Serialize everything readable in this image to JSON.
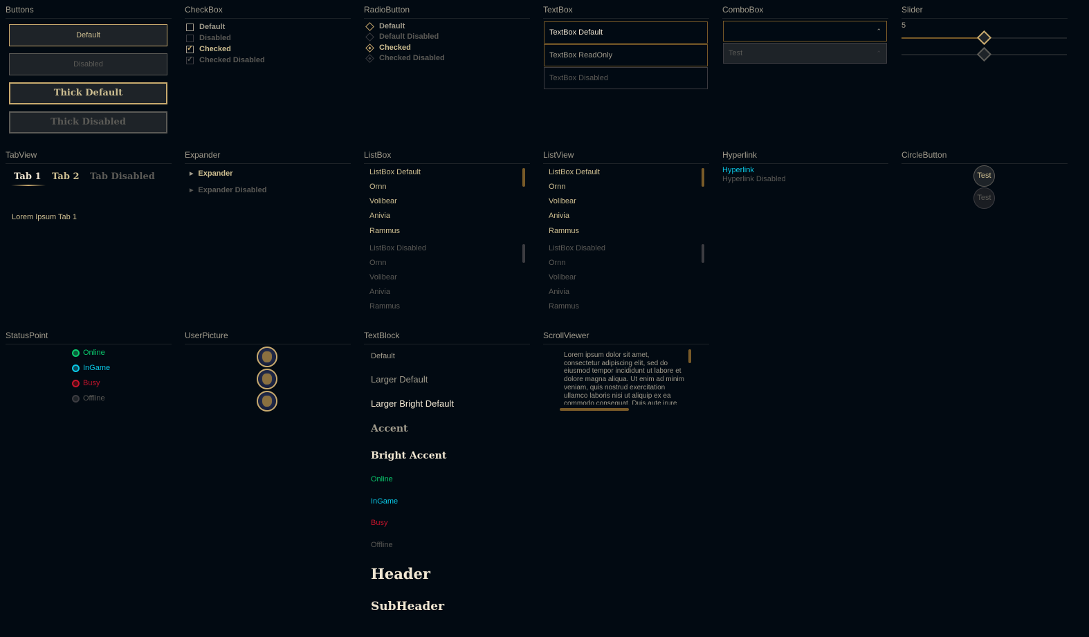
{
  "sections": {
    "buttons": "Buttons",
    "checkbox": "CheckBox",
    "radiobutton": "RadioButton",
    "textbox": "TextBox",
    "combobox": "ComboBox",
    "slider": "Slider",
    "tabview": "TabView",
    "expander": "Expander",
    "listbox": "ListBox",
    "listview": "ListView",
    "hyperlink": "Hyperlink",
    "circlebutton": "CircleButton",
    "statuspoint": "StatusPoint",
    "userpicture": "UserPicture",
    "textblock": "TextBlock",
    "scrollviewer": "ScrollViewer"
  },
  "buttons": {
    "default": "Default",
    "disabled": "Disabled",
    "thick_default": "Thick Default",
    "thick_disabled": "Thick Disabled"
  },
  "checkbox": {
    "default": "Default",
    "disabled": "Disabled",
    "checked": "Checked",
    "checked_disabled": "Checked Disabled",
    "check_glyph": "✓"
  },
  "radiobutton": {
    "default": "Default",
    "default_disabled": "Default Disabled",
    "checked": "Checked",
    "checked_disabled": "Checked Disabled"
  },
  "textbox": {
    "default": "TextBox Default",
    "readonly": "TextBox ReadOnly",
    "disabled": "TextBox Disabled"
  },
  "combobox": {
    "default_value": "",
    "disabled_value": "Test",
    "arrow_glyph": "⌃⌄"
  },
  "slider": {
    "value_label": "5",
    "value_fraction": 0.5,
    "disabled_fraction": 0.5
  },
  "tabview": {
    "tabs": [
      "Tab 1",
      "Tab 2",
      "Tab Disabled"
    ],
    "content": "Lorem Ipsum Tab 1"
  },
  "expander": {
    "default": "Expander",
    "disabled": "Expander Disabled",
    "arrow_glyph": "▶"
  },
  "listbox": {
    "enabled_items": [
      "ListBox Default",
      "Ornn",
      "Volibear",
      "Anivia",
      "Rammus"
    ],
    "disabled_items": [
      "ListBox Disabled",
      "Ornn",
      "Volibear",
      "Anivia",
      "Rammus"
    ]
  },
  "listview": {
    "enabled_items": [
      "ListBox Default",
      "Ornn",
      "Volibear",
      "Anivia",
      "Rammus"
    ],
    "disabled_items": [
      "ListBox Disabled",
      "Ornn",
      "Volibear",
      "Anivia",
      "Rammus"
    ]
  },
  "hyperlink": {
    "default": "Hyperlink",
    "disabled": "Hyperlink Disabled"
  },
  "circlebutton": {
    "default": "Test",
    "disabled": "Test"
  },
  "statuspoint": {
    "online": "Online",
    "ingame": "InGame",
    "busy": "Busy",
    "offline": "Offline"
  },
  "textblock": {
    "default": "Default",
    "larger_default": "Larger Default",
    "larger_bright_default": "Larger Bright Default",
    "accent": "Accent",
    "bright_accent": "Bright Accent",
    "online": "Online",
    "ingame": "InGame",
    "busy": "Busy",
    "offline": "Offline",
    "header": "Header",
    "subheader": "SubHeader"
  },
  "scrollviewer": {
    "text": "Lorem ipsum dolor sit amet, consectetur adipiscing elit, sed do eiusmod tempor incididunt ut labore et dolore magna aliqua. Ut enim ad minim veniam, quis nostrud exercitation ullamco laboris nisi ut aliquip ex ea commodo consequat. Duis aute irure dolor in reprehenderit in voluptate velit esse cillum dolore eu fugiat nulla pariatur. Excepteur sint occaecat cupidatat non proident, sunt in culpa qui officia deserunt mollit anim id est laborum."
  },
  "colors": {
    "gold": "#c8aa6e",
    "dark_gold": "#785a28",
    "online": "#0acb6e",
    "ingame": "#0ac8e6",
    "busy": "#c4142c",
    "offline": "#5b5a56"
  }
}
